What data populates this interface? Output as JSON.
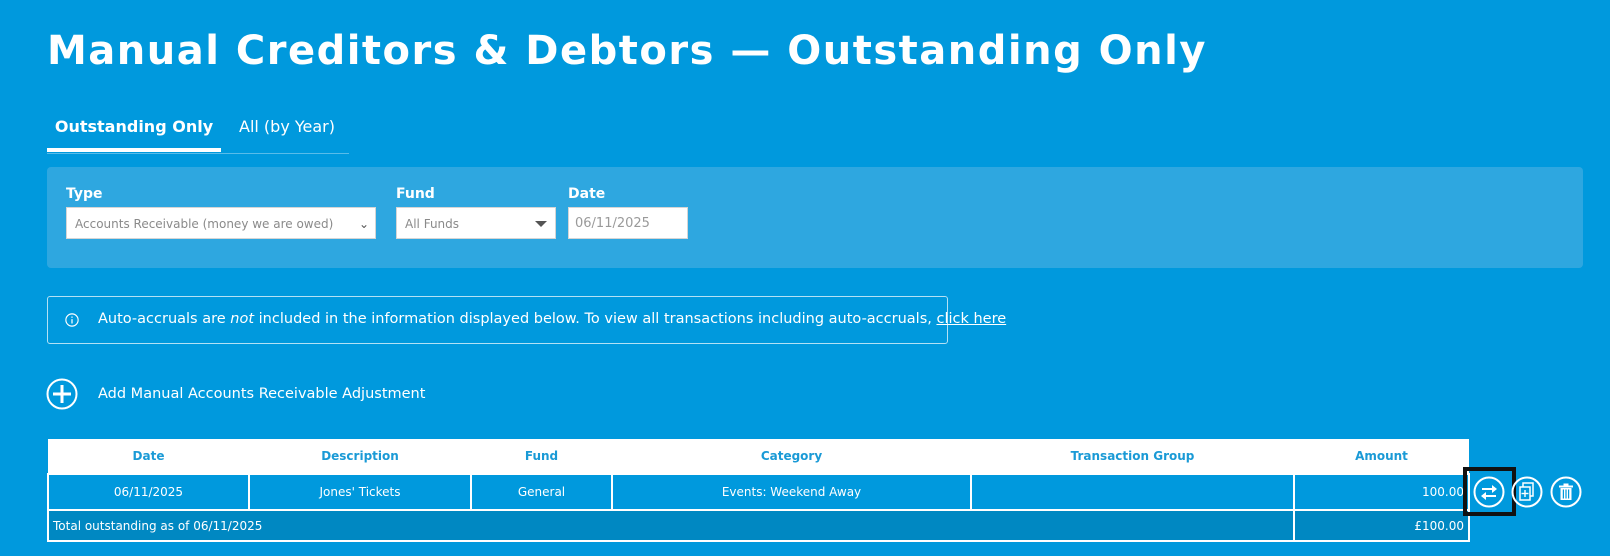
{
  "page": {
    "title": "Manual Creditors & Debtors — Outstanding Only"
  },
  "tabs": [
    {
      "label": "Outstanding Only",
      "active": true
    },
    {
      "label": "All (by Year)",
      "active": false
    }
  ],
  "filters": {
    "type_label": "Type",
    "type_value": "Accounts Receivable (money we are owed)",
    "fund_label": "Fund",
    "fund_value": "All Funds",
    "date_label": "Date",
    "date_value": "06/11/2025"
  },
  "info": {
    "text_before": "Auto-accruals are ",
    "text_em": "not",
    "text_after": " included in the information displayed below. To view all transactions including auto-accruals, ",
    "link": "click here",
    "icon": "info-icon"
  },
  "add": {
    "label": "Add Manual Accounts Receivable Adjustment",
    "icon": "plus-circle-icon"
  },
  "table": {
    "headers": [
      "Date",
      "Description",
      "Fund",
      "Category",
      "Transaction Group",
      "Amount"
    ],
    "rows": [
      {
        "date": "06/11/2025",
        "description": "Jones' Tickets",
        "fund": "General",
        "category": "Events: Weekend Away",
        "transaction_group": "",
        "amount": "100.00"
      }
    ],
    "total_label": "Total outstanding as of 06/11/2025",
    "total_amount": "£100.00"
  },
  "row_actions": [
    "swap-arrows-icon",
    "copy-add-icon",
    "trash-icon"
  ],
  "colors": {
    "background": "#0099dd",
    "panel": "#2ea7e0",
    "header_text": "#1a9ad6",
    "total_row": "#0088c2"
  }
}
